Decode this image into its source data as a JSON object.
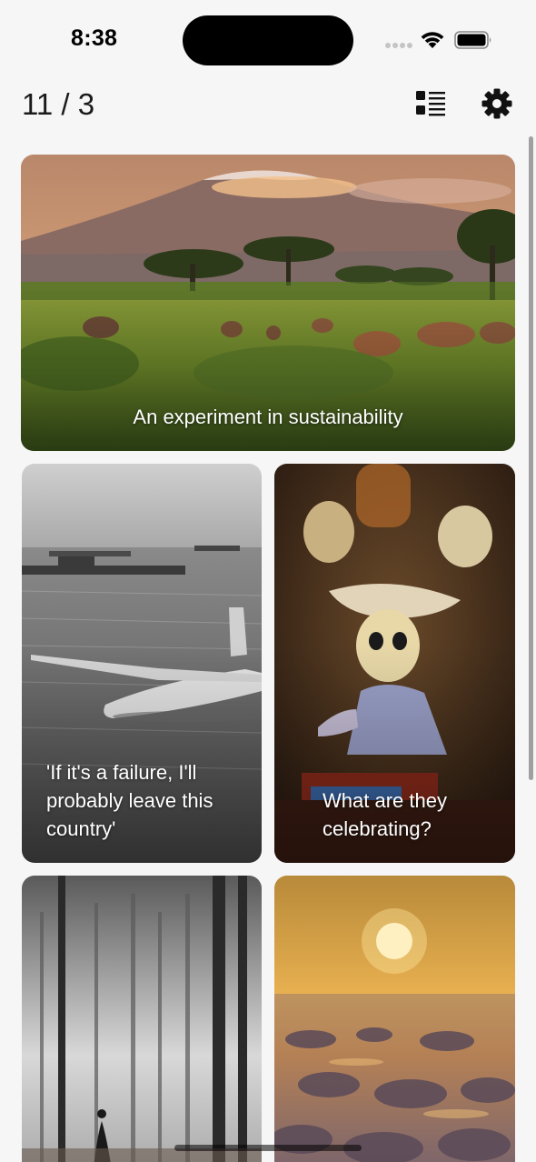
{
  "status_bar": {
    "time": "8:38",
    "icons": [
      "cellular-signal-icon",
      "wifi-icon",
      "battery-icon"
    ]
  },
  "header": {
    "page_counter": "11 / 3",
    "list_toggle_icon": "list-view-icon",
    "settings_icon": "gear-icon"
  },
  "feed": {
    "cards": [
      {
        "caption": "An experiment in sustainability",
        "image": "savanna-buffalo-mountain-photo"
      },
      {
        "caption": "'If it's a failure, I'll probably leave this country'",
        "image": "seaplane-warships-photo"
      },
      {
        "caption": "What are they celebrating?",
        "image": "skeleton-figurine-photo"
      },
      {
        "caption": "",
        "image": "misty-forest-photo"
      },
      {
        "caption": "",
        "image": "arctic-sunset-photo"
      }
    ]
  },
  "colors": {
    "background": "#f6f6f6",
    "caption_text": "#ffffff",
    "icon": "#111111"
  }
}
